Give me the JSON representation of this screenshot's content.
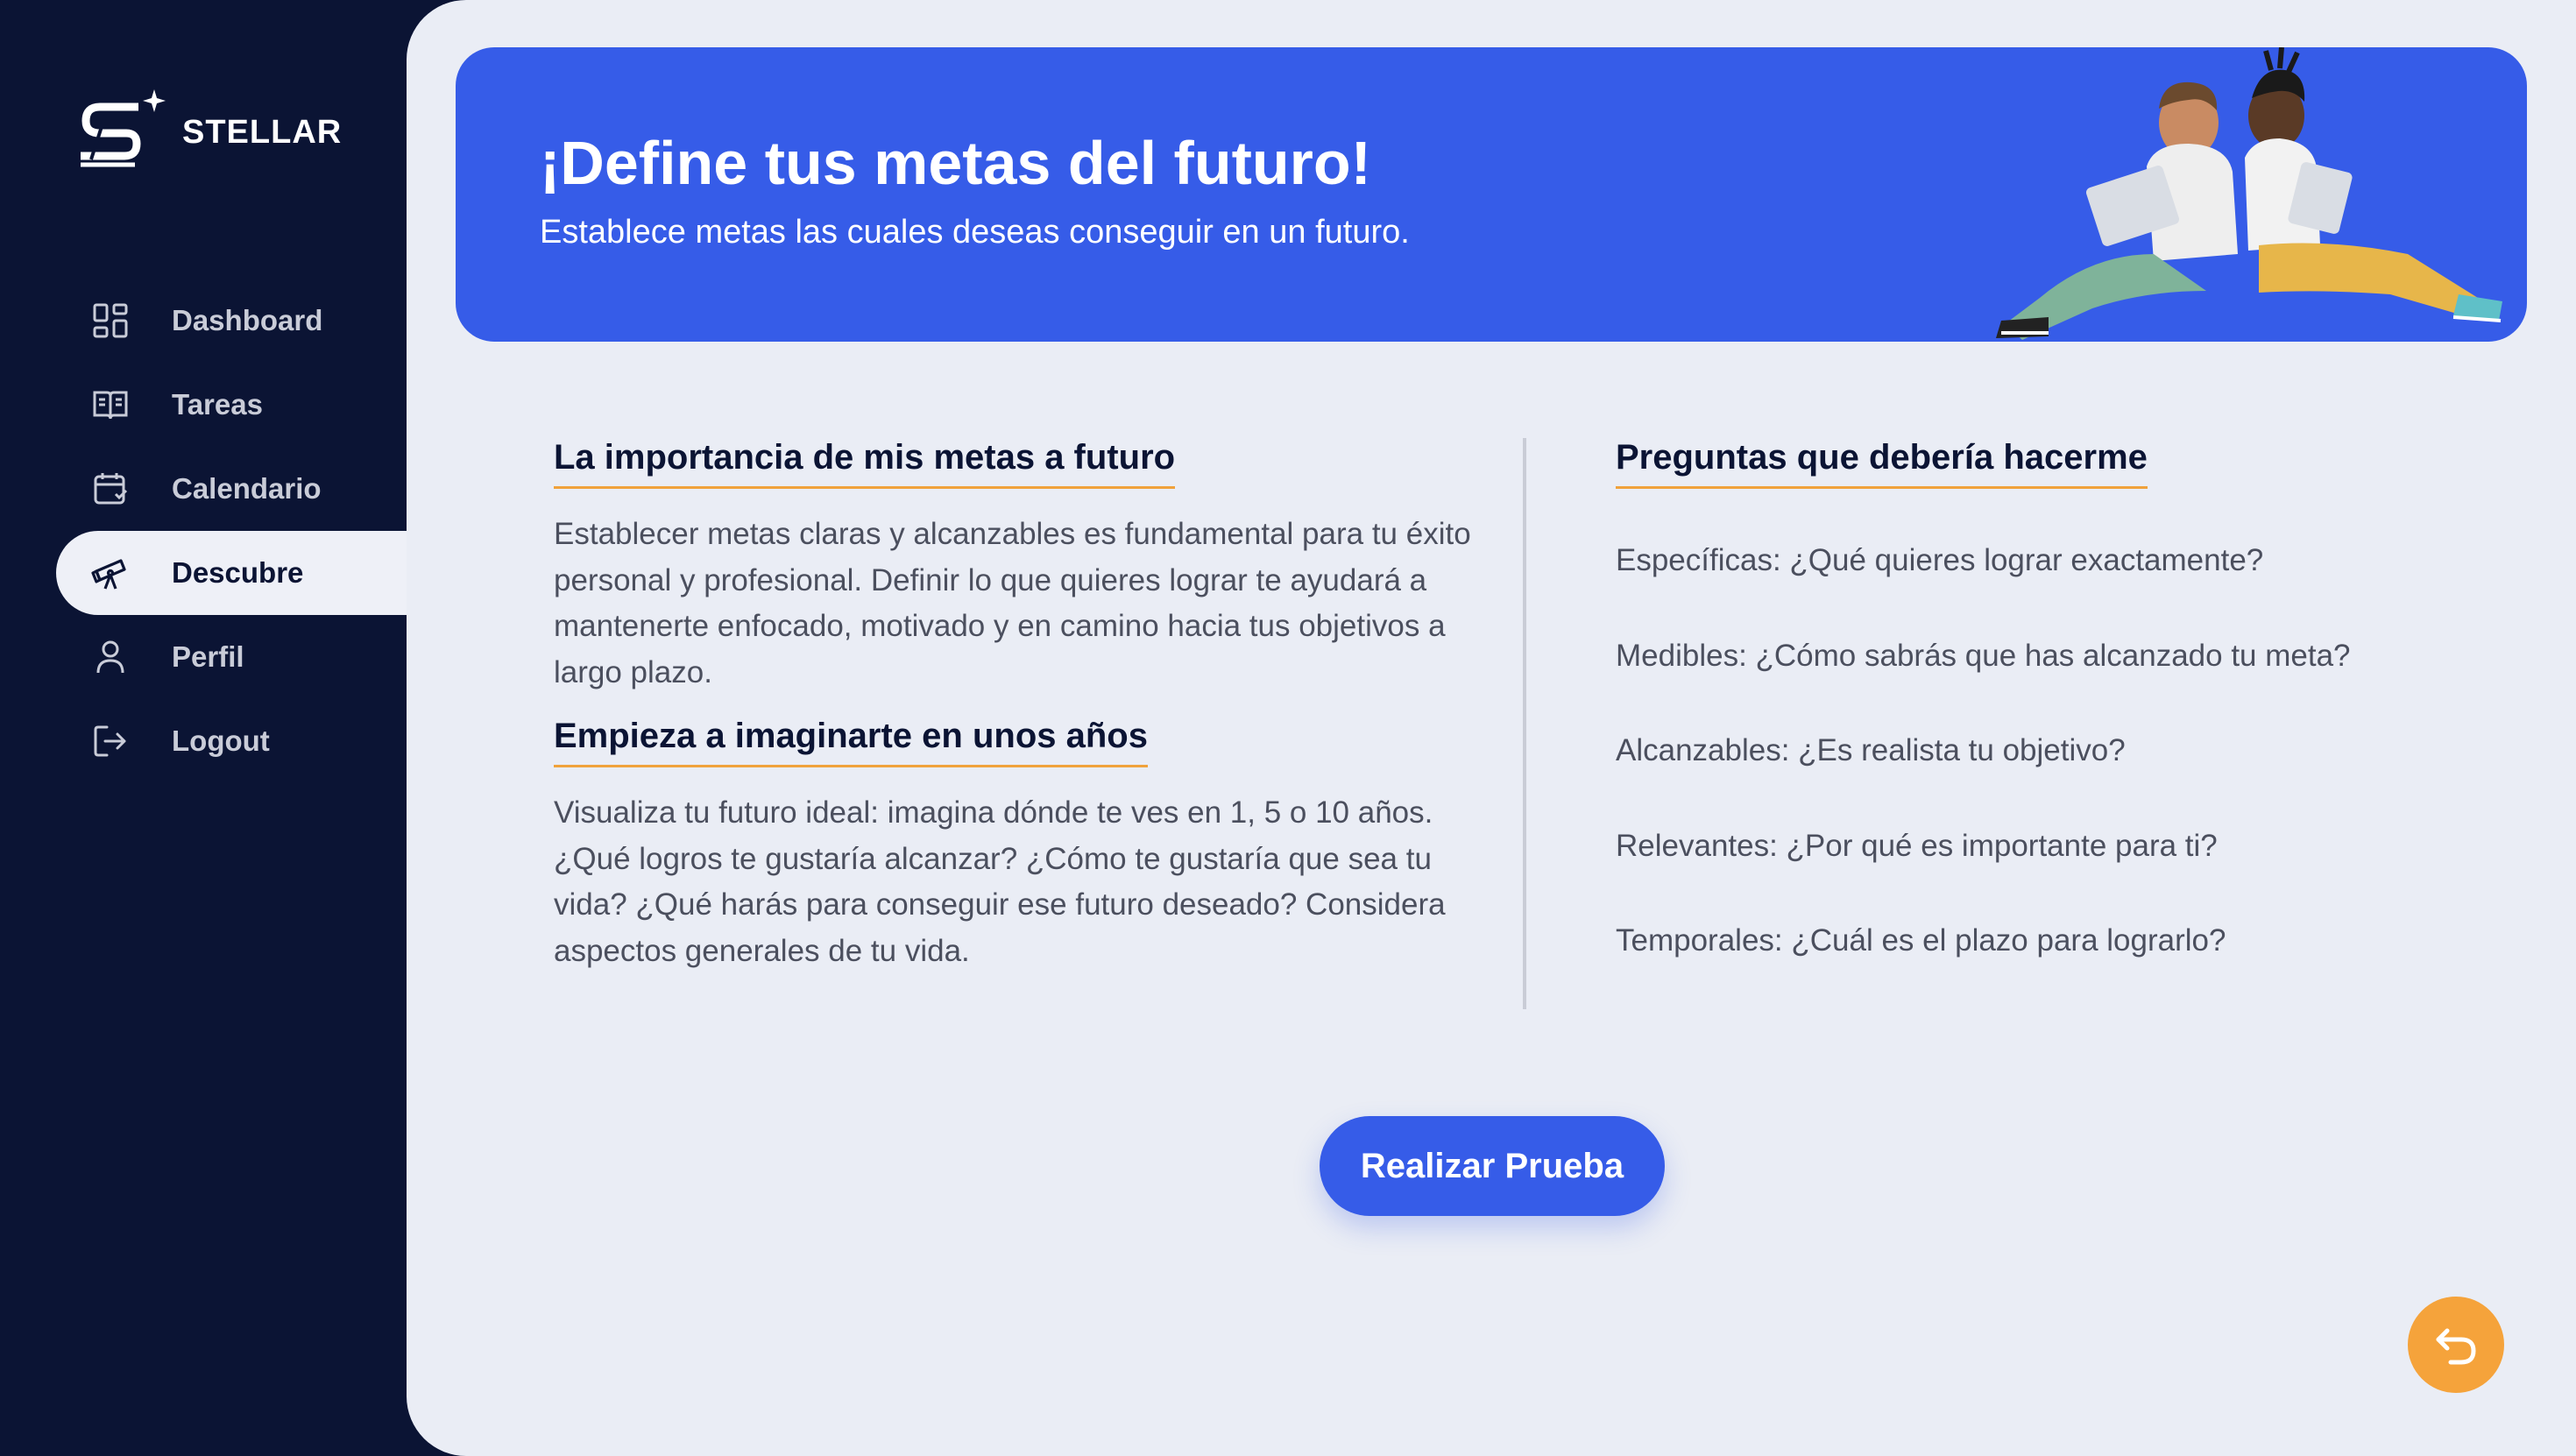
{
  "brand": {
    "name": "STELLAR"
  },
  "sidebar": {
    "items": [
      {
        "label": "Dashboard",
        "icon": "dashboard-grid-icon"
      },
      {
        "label": "Tareas",
        "icon": "book-icon"
      },
      {
        "label": "Calendario",
        "icon": "calendar-icon"
      },
      {
        "label": "Descubre",
        "icon": "telescope-icon",
        "active": true
      },
      {
        "label": "Perfil",
        "icon": "user-icon"
      },
      {
        "label": "Logout",
        "icon": "logout-icon"
      }
    ]
  },
  "banner": {
    "title": "¡Define tus metas del futuro!",
    "subtitle": "Establece metas las cuales deseas conseguir en un futuro."
  },
  "left": {
    "section1_title": "La importancia de mis metas a futuro",
    "section1_text": "Establecer metas claras y alcanzables es fundamental para tu éxito personal y profesional. Definir lo que quieres lograr te ayudará a mantenerte enfocado, motivado y en camino hacia tus objetivos a largo plazo.",
    "section2_title": "Empieza a imaginarte en unos años",
    "section2_text": "Visualiza tu futuro ideal: imagina dónde te ves en 1, 5 o 10 años. ¿Qué logros te gustaría alcanzar? ¿Cómo te gustaría que sea tu vida? ¿Qué harás para conseguir ese futuro deseado? Considera aspectos generales de tu vida."
  },
  "right": {
    "title": "Preguntas que debería hacerme",
    "questions": [
      "Específicas: ¿Qué quieres lograr exactamente?",
      "Medibles: ¿Cómo sabrás que has alcanzado tu meta?",
      "Alcanzables: ¿Es realista tu objetivo?",
      "Relevantes: ¿Por qué es importante para ti?",
      "Temporales: ¿Cuál es el plazo para lograrlo?"
    ]
  },
  "cta": {
    "label": "Realizar Prueba"
  },
  "fab": {
    "icon": "undo-arrow-icon"
  },
  "colors": {
    "sidebar_bg": "#0b1434",
    "content_bg": "#eaedf5",
    "primary": "#365ce8",
    "accent": "#f5a33b"
  }
}
